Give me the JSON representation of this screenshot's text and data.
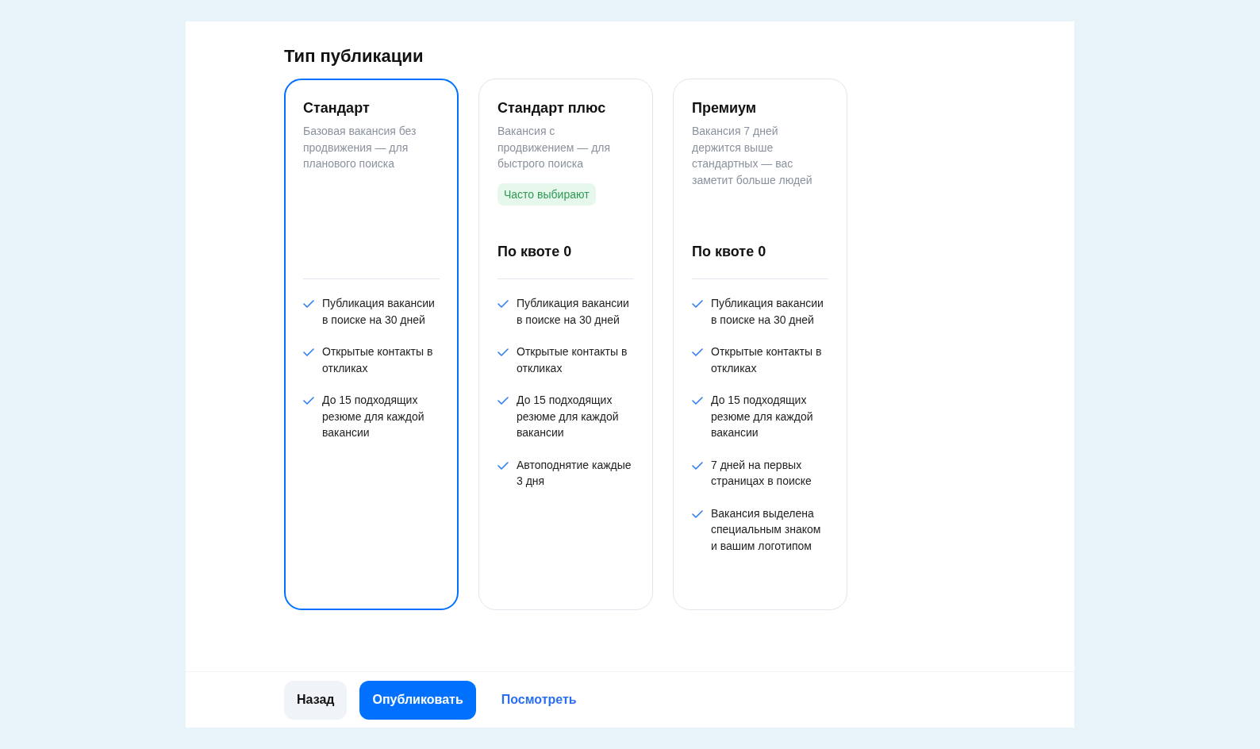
{
  "title": "Тип публикации",
  "plans": [
    {
      "name": "Стандарт",
      "selected": true,
      "description": "Базовая вакансия без продвижения — для планового поиска",
      "features": [
        "Публикация вакансии в поиске на 30 дней",
        "Открытые контакты в откликах",
        "До 15 подходящих резюме для каждой вакансии"
      ]
    },
    {
      "name": "Стандарт плюс",
      "selected": false,
      "description": "Вакансия с продвижением — для быстрого поиска",
      "badge": "Часто выбирают",
      "quota": "По квоте 0",
      "features": [
        "Публикация вакансии в поиске на 30 дней",
        "Открытые контакты в откликах",
        "До 15 подходящих резюме для каждой вакансии",
        "Автоподнятие каждые 3 дня"
      ]
    },
    {
      "name": "Премиум",
      "selected": false,
      "description": "Вакансия 7 дней держится выше стандартных — вас заметит больше людей",
      "quota": "По квоте 0",
      "features": [
        "Публикация вакансии в поиске на 30 дней",
        "Открытые контакты в откликах",
        "До 15 подходящих резюме для каждой вакансии",
        "7 дней на первых страницах в поиске",
        "Вакансия выделена специальным знаком и вашим логотипом"
      ]
    }
  ],
  "actions": [
    {
      "kind": "secondary",
      "label": "Назад"
    },
    {
      "kind": "primary",
      "label": "Опубликовать"
    },
    {
      "kind": "link",
      "label": "Посмотреть"
    }
  ]
}
